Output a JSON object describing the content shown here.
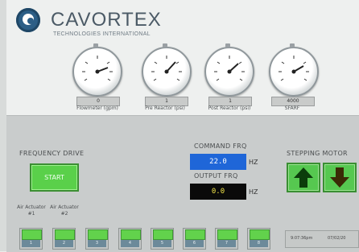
{
  "header": {
    "brand": "CAVORTEX",
    "tagline": "TECHNOLOGIES INTERNATIONAL"
  },
  "gauges": [
    {
      "label": "Flowmeter (gpm)",
      "value": "0"
    },
    {
      "label": "Pre Reactor (psi)",
      "value": "1"
    },
    {
      "label": "Post Reactor (psi)",
      "value": "1"
    },
    {
      "label": "SFARF",
      "value": "4000"
    }
  ],
  "frequency_drive": {
    "title": "FREQUENCY DRIVE",
    "start_label": "START"
  },
  "command_frq": {
    "title": "COMMAND FRQ",
    "value": "22.0",
    "unit": "HZ",
    "bg": "#1f66d8"
  },
  "output_frq": {
    "title": "OUTPUT FRQ",
    "value": "0.0",
    "unit": "HZ",
    "bg": "#0a0a0a",
    "fg": "#f3e64a"
  },
  "stepping_motor": {
    "title": "STEPPING MOTOR",
    "up_icon": "arrow-up-icon",
    "down_icon": "arrow-down-icon"
  },
  "actuator_labels": [
    "Air Actuator #1",
    "Air Actuator #2"
  ],
  "actuators": [
    "1",
    "2",
    "3",
    "4",
    "5",
    "6",
    "7",
    "8"
  ],
  "status_bar": {
    "time": "9:07:36pm",
    "date": "07/02/20"
  }
}
